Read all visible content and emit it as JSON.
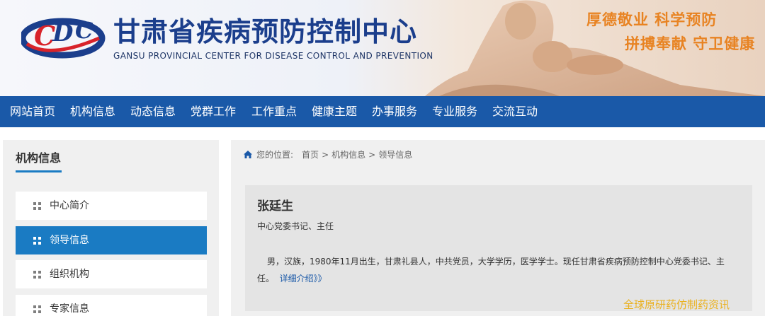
{
  "header": {
    "logo_text": "CDC",
    "site_name_cn": "甘肃省疾病预防控制中心",
    "site_name_en": "GANSU PROVINCIAL CENTER FOR DISEASE CONTROL AND PREVENTION",
    "slogan_1": "厚德敬业  科学预防",
    "slogan_2": "拼搏奉献  守卫健康"
  },
  "nav": {
    "items": [
      "网站首页",
      "机构信息",
      "动态信息",
      "党群工作",
      "工作重点",
      "健康主题",
      "办事服务",
      "专业服务",
      "交流互动"
    ]
  },
  "sidebar": {
    "title": "机构信息",
    "items": [
      {
        "label": "中心简介",
        "active": false
      },
      {
        "label": "领导信息",
        "active": true
      },
      {
        "label": "组织机构",
        "active": false
      },
      {
        "label": "专家信息",
        "active": false
      }
    ]
  },
  "breadcrumb": {
    "prefix": "您的位置:",
    "items": [
      "首页",
      "机构信息",
      "领导信息"
    ],
    "separator": ">"
  },
  "leader": {
    "name": "张廷生",
    "title": "中心党委书记、主任",
    "bio": "男，汉族，1980年11月出生，甘肃礼县人，中共党员，大学学历，医学学士。现任甘肃省疾病预防控制中心党委书记、主任。",
    "more_label": "详细介绍》》"
  },
  "watermark": "全球原研药仿制药资讯",
  "colors": {
    "nav_bg": "#1a59a8",
    "accent": "#1a7bc3",
    "slogan": "#e88322",
    "link": "#1a59a8"
  }
}
